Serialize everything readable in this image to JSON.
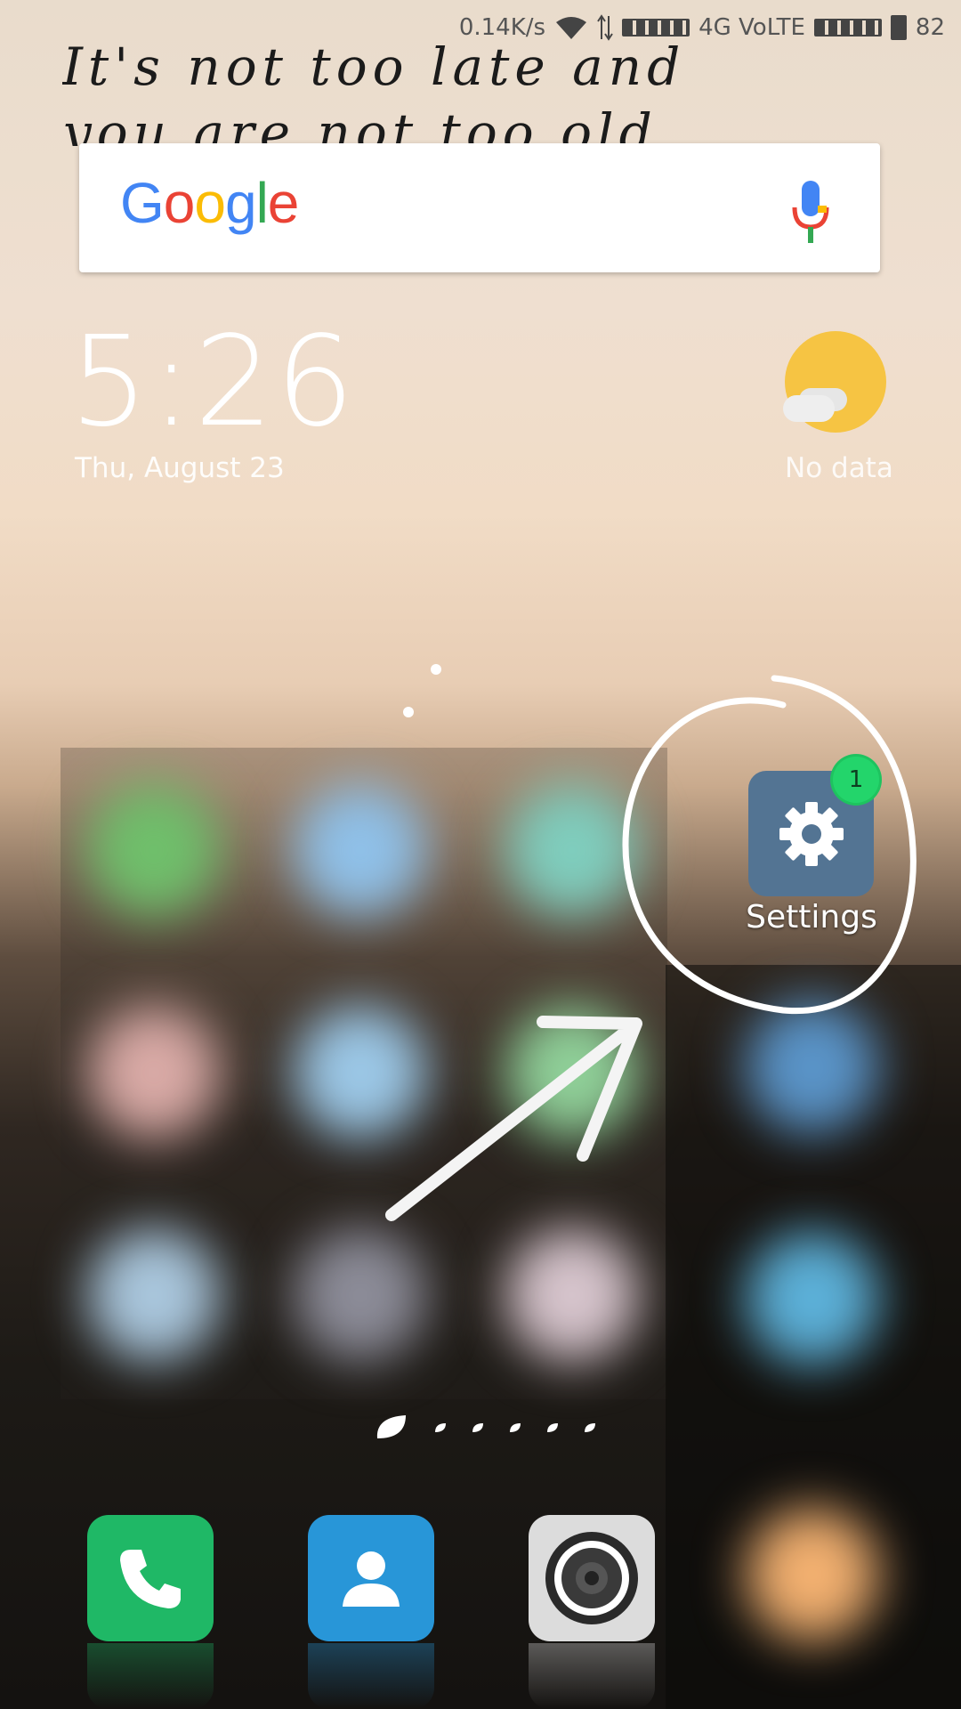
{
  "status_bar": {
    "speed": "0.14K/s",
    "network": "4G VoLTE",
    "battery": "82",
    "icons": [
      "wifi-icon",
      "data-arrows-icon",
      "signal-icon",
      "signal-icon",
      "battery-icon"
    ]
  },
  "quote": "It's not too late and\nyou are not too old..",
  "search": {
    "logo": [
      "G",
      "o",
      "o",
      "g",
      "l",
      "e"
    ],
    "logo_colors": [
      "#4285F4",
      "#EA4335",
      "#FBBC05",
      "#4285F4",
      "#34A853",
      "#EA4335"
    ],
    "icon": "mic-icon"
  },
  "clock": {
    "time": "5:26",
    "date": "Thu, August 23"
  },
  "weather": {
    "status": "No data",
    "icon": "partly-cloudy-icon"
  },
  "settings_app": {
    "label": "Settings",
    "badge": "1",
    "icon": "gear-icon",
    "color": "#537493"
  },
  "dock": [
    {
      "name": "phone",
      "icon": "phone-icon",
      "color": "#1fb866"
    },
    {
      "name": "contacts",
      "icon": "contacts-icon",
      "color": "#2896d8"
    },
    {
      "name": "camera",
      "icon": "camera-icon",
      "color": "#dcdcdc"
    }
  ]
}
